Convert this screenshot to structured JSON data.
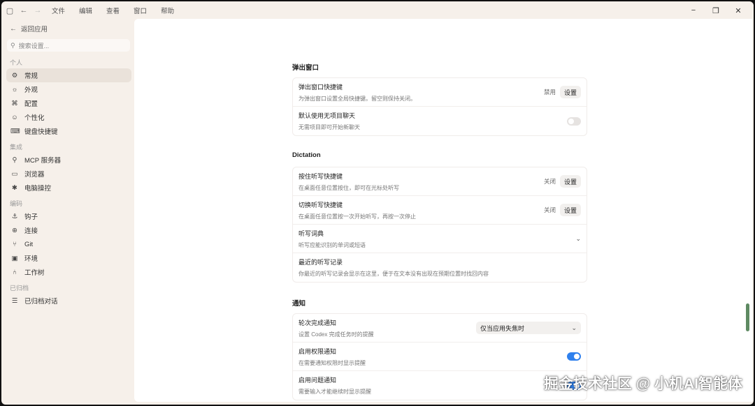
{
  "menu": [
    "文件",
    "编辑",
    "查看",
    "窗口",
    "帮助"
  ],
  "sidebar": {
    "back_label": "返回应用",
    "search_placeholder": "搜索设置...",
    "sections": [
      {
        "label": "个人",
        "items": [
          {
            "label": "常规",
            "icon": "gear-icon",
            "glyph": "⚙",
            "active": true
          },
          {
            "label": "外观",
            "icon": "sun-icon",
            "glyph": "☼"
          },
          {
            "label": "配置",
            "icon": "config-icon",
            "glyph": "⌘"
          },
          {
            "label": "个性化",
            "icon": "personalize-icon",
            "glyph": "☺"
          },
          {
            "label": "键盘快捷键",
            "icon": "keyboard-icon",
            "glyph": "⌨"
          }
        ]
      },
      {
        "label": "集成",
        "items": [
          {
            "label": "MCP 服务器",
            "icon": "plug-icon",
            "glyph": "⚲"
          },
          {
            "label": "浏览器",
            "icon": "browser-icon",
            "glyph": "▭"
          },
          {
            "label": "电脑操控",
            "icon": "control-icon",
            "glyph": "✱"
          }
        ]
      },
      {
        "label": "编码",
        "items": [
          {
            "label": "钩子",
            "icon": "hook-icon",
            "glyph": "⚓"
          },
          {
            "label": "连接",
            "icon": "globe-icon",
            "glyph": "⊕"
          },
          {
            "label": "Git",
            "icon": "git-icon",
            "glyph": "⑂"
          },
          {
            "label": "环境",
            "icon": "terminal-icon",
            "glyph": "▣"
          },
          {
            "label": "工作树",
            "icon": "tree-icon",
            "glyph": "⑃"
          }
        ]
      },
      {
        "label": "已归档",
        "items": [
          {
            "label": "已归档对话",
            "icon": "archive-icon",
            "glyph": "☰"
          }
        ]
      }
    ]
  },
  "groups": [
    {
      "title": "弹出窗口",
      "rows": [
        {
          "title": "弹出窗口快捷键",
          "desc": "为弹出窗口设置全局快捷键。留空则保持关闭。",
          "control": "button",
          "status": "禁用",
          "button": "设置"
        },
        {
          "title": "默认使用无项目聊天",
          "desc": "无需项目即可开始新聊天",
          "control": "toggle",
          "on": false
        }
      ]
    },
    {
      "title": "Dictation",
      "rows": [
        {
          "title": "按住听写快捷键",
          "desc": "在桌面任意位置按住，即可在光标处听写",
          "control": "button",
          "status": "关闭",
          "button": "设置"
        },
        {
          "title": "切换听写快捷键",
          "desc": "在桌面任意位置按一次开始听写，再按一次停止",
          "control": "button",
          "status": "关闭",
          "button": "设置"
        },
        {
          "title": "听写词典",
          "desc": "听写应能识别的单词或短语",
          "control": "chevron"
        },
        {
          "title": "最近的听写记录",
          "desc": "你最近的听写记录会显示在这里，便于在文本没有出现在预期位置时找回内容",
          "control": "none"
        }
      ]
    },
    {
      "title": "通知",
      "rows": [
        {
          "title": "轮次完成通知",
          "desc": "设置 Codex 完成任务时的提醒",
          "control": "select",
          "select": "仅当应用失焦时"
        },
        {
          "title": "启用权限通知",
          "desc": "在需要通知权限时显示提醒",
          "control": "toggle",
          "on": true
        },
        {
          "title": "启用问题通知",
          "desc": "需要输入才能继续时显示提醒",
          "control": "toggle",
          "on": true
        }
      ]
    }
  ],
  "watermark": "掘金技术社区 @ 小机AI智能体"
}
